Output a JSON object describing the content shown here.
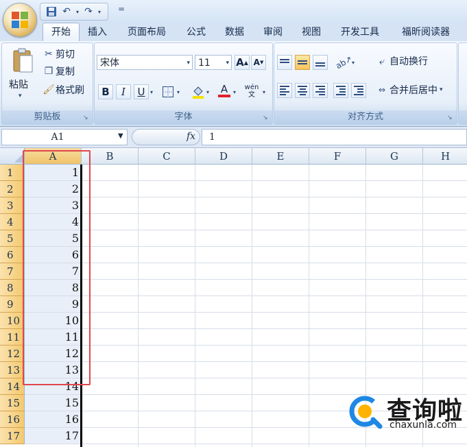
{
  "quick_access": {
    "save": "save-icon",
    "undo": "undo-icon",
    "redo": "redo-icon",
    "customize": "="
  },
  "tabs": [
    {
      "label": "开始",
      "active": true
    },
    {
      "label": "插入"
    },
    {
      "label": "页面布局"
    },
    {
      "label": "公式"
    },
    {
      "label": "数据"
    },
    {
      "label": "审阅"
    },
    {
      "label": "视图"
    },
    {
      "label": "开发工具"
    },
    {
      "label": "福昕阅读器"
    }
  ],
  "clipboard": {
    "paste": "粘贴",
    "cut": "剪切",
    "copy": "复制",
    "format_painter": "格式刷",
    "group_label": "剪贴板"
  },
  "font": {
    "name": "宋体",
    "size": "11",
    "bold": "B",
    "italic": "I",
    "underline": "U",
    "font_color": "A",
    "phonetic": "wén 文",
    "group_label": "字体",
    "font_color_hex": "#e0202a",
    "fill_color_hex": "#f5e100"
  },
  "alignment": {
    "wrap_text": "自动换行",
    "merge_center": "合并后居中",
    "group_label": "对齐方式"
  },
  "formula_bar": {
    "name_box": "A1",
    "fx": "fx",
    "value": "1"
  },
  "grid": {
    "columns": [
      "A",
      "B",
      "C",
      "D",
      "E",
      "F",
      "G",
      "H"
    ],
    "selected_column": "A",
    "rows": [
      "1",
      "2",
      "3",
      "4",
      "5",
      "6",
      "7",
      "8",
      "9",
      "10",
      "11",
      "12",
      "13",
      "14",
      "15",
      "16",
      "17"
    ],
    "column_a_values": [
      "1",
      "2",
      "3",
      "4",
      "5",
      "6",
      "7",
      "8",
      "9",
      "10",
      "11",
      "12",
      "13",
      "14",
      "15",
      "16",
      "17"
    ]
  },
  "highlight_color": "#e0474c",
  "watermark": {
    "name": "查询啦",
    "url": "chaxunla.com"
  }
}
